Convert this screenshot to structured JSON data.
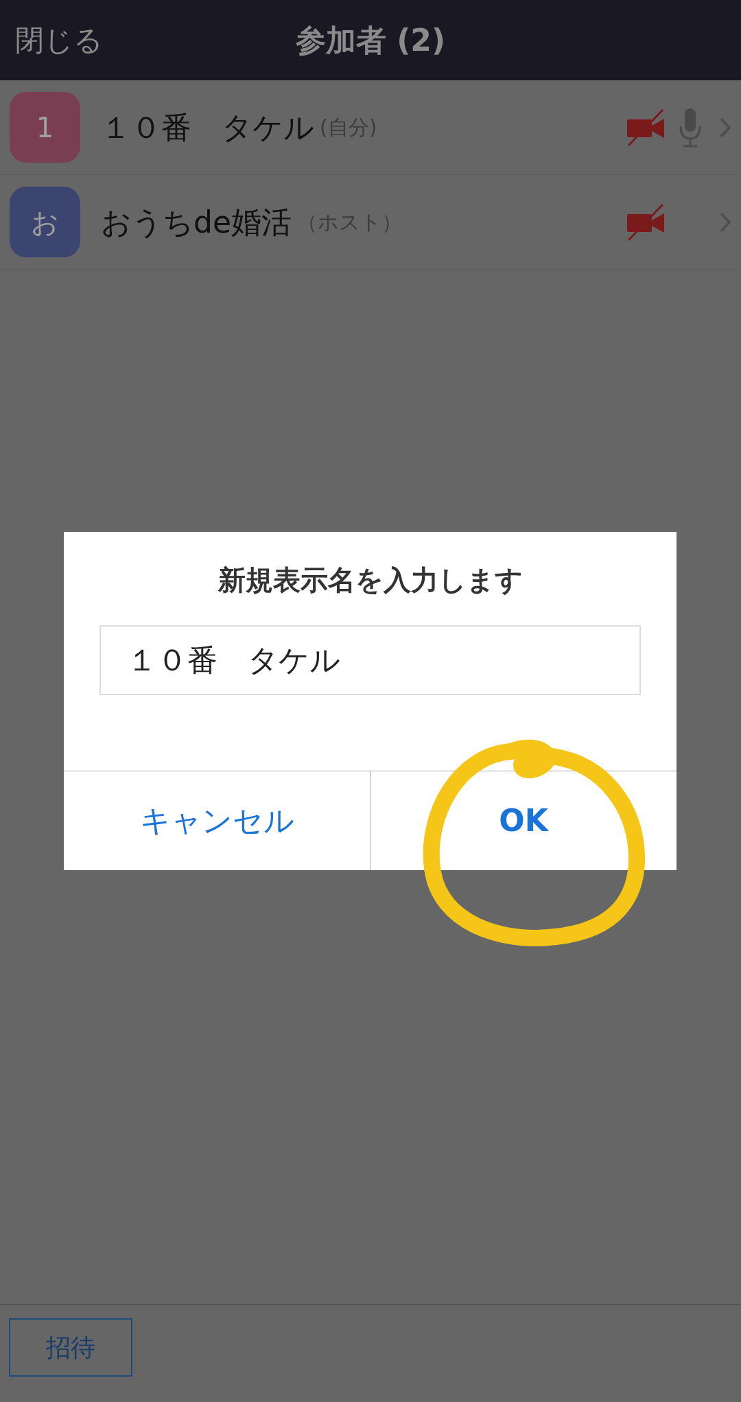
{
  "header": {
    "close": "閉じる",
    "title": "参加者 (2)"
  },
  "participants": [
    {
      "avatar": "1",
      "color": "#7a3e52",
      "name": "１０番　タケル",
      "tag": "(自分)",
      "video_muted": true,
      "mic": true
    },
    {
      "avatar": "お",
      "color": "#3c4470",
      "name": "おうちde婚活",
      "tag": "（ホスト）",
      "video_muted": true,
      "mic": false
    }
  ],
  "dialog": {
    "title": "新規表示名を入力します",
    "value": "１０番　タケル",
    "buttons": [
      {
        "label": "キャンセル",
        "bold": false
      },
      {
        "label": "OK",
        "bold": true
      }
    ]
  },
  "footer": {
    "invite": "招待"
  }
}
